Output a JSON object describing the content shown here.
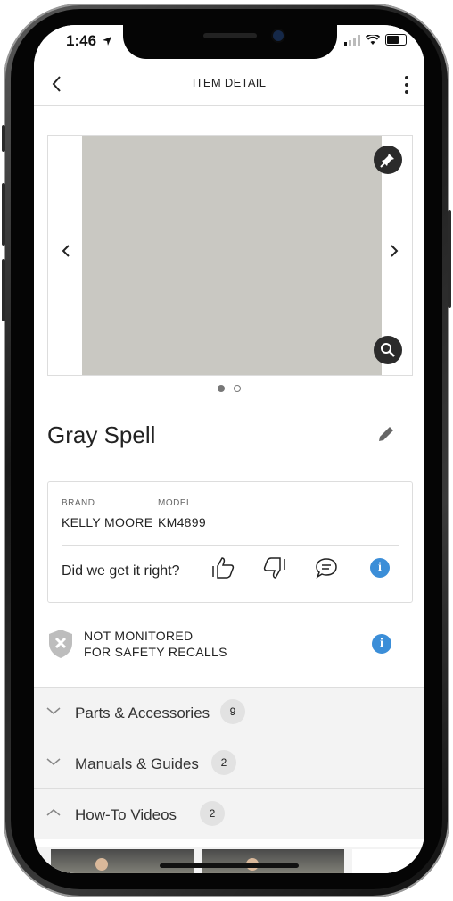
{
  "status": {
    "time": "1:46"
  },
  "nav": {
    "title": "ITEM DETAIL"
  },
  "item": {
    "name": "Gray Spell",
    "swatch_color": "#c9c8c2",
    "gallery_pages": 2,
    "gallery_active": 1
  },
  "details": {
    "brand_label": "BRAND",
    "brand_value": "KELLY MOORE",
    "model_label": "MODEL",
    "model_value": "KM4899",
    "feedback_question": "Did we get it right?"
  },
  "safety": {
    "line1": "NOT MONITORED",
    "line2": "FOR SAFETY RECALLS"
  },
  "sections": [
    {
      "label": "Parts & Accessories",
      "count": "9",
      "expanded": false
    },
    {
      "label": "Manuals & Guides",
      "count": "2",
      "expanded": false
    },
    {
      "label": "How-To Videos",
      "count": "2",
      "expanded": true
    }
  ],
  "colors": {
    "accent": "#3b8ed8",
    "swatch": "#c9c8c2"
  }
}
